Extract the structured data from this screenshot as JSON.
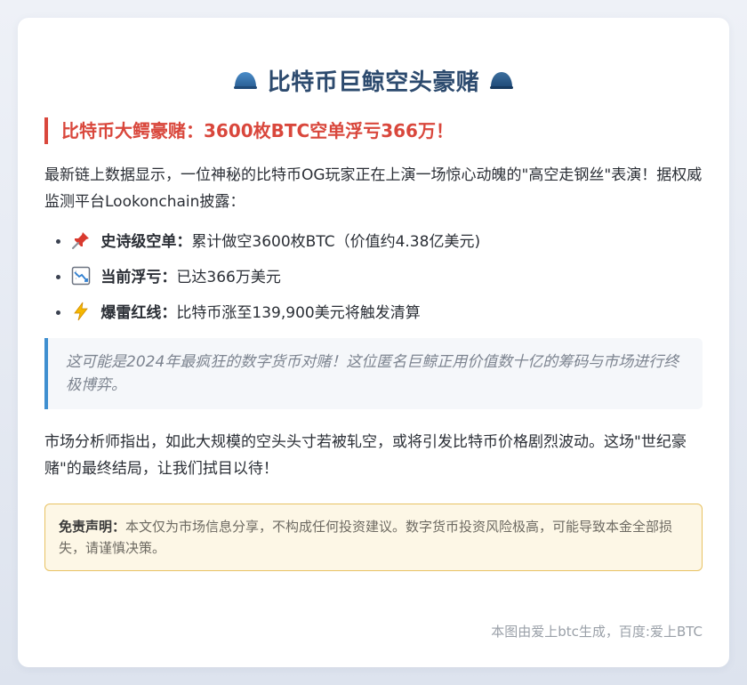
{
  "header": {
    "title": "比特币巨鲸空头豪赌",
    "left_icon": "whale-icon",
    "right_icon": "whale-icon"
  },
  "subtitle": "比特币大鳄豪赌：3600枚BTC空单浮亏366万！",
  "intro": "最新链上数据显示，一位神秘的比特币OG玩家正在上演一场惊心动魄的\"高空走钢丝\"表演！据权威监测平台Lookonchain披露：",
  "points": [
    {
      "icon": "pushpin-icon",
      "label": "史诗级空单：",
      "text": "累计做空3600枚BTC（价值约4.38亿美元)"
    },
    {
      "icon": "chart-decreasing-icon",
      "label": "当前浮亏：",
      "text": "已达366万美元"
    },
    {
      "icon": "lightning-icon",
      "label": "爆雷红线：",
      "text": "比特币涨至139,900美元将触发清算"
    }
  ],
  "quote": "这可能是2024年最疯狂的数字货币对赌！这位匿名巨鲸正用价值数十亿的筹码与市场进行终极博弈。",
  "analysis": "市场分析师指出，如此大规模的空头头寸若被轧空，或将引发比特币价格剧烈波动。这场\"世纪豪赌\"的最终结局，让我们拭目以待！",
  "disclaimer": {
    "label": "免责声明：",
    "text": "本文仅为市场信息分享，不构成任何投资建议。数字货币投资风险极高，可能导致本金全部损失，请谨慎决策。"
  },
  "footer": "本图由爱上btc生成，百度:爱上BTC",
  "colors": {
    "title": "#2c4a6e",
    "accent_red": "#d9473c",
    "quote_border": "#3f8fd0",
    "disclaimer_border": "#e8c263",
    "disclaimer_bg": "#fdf7e6"
  }
}
